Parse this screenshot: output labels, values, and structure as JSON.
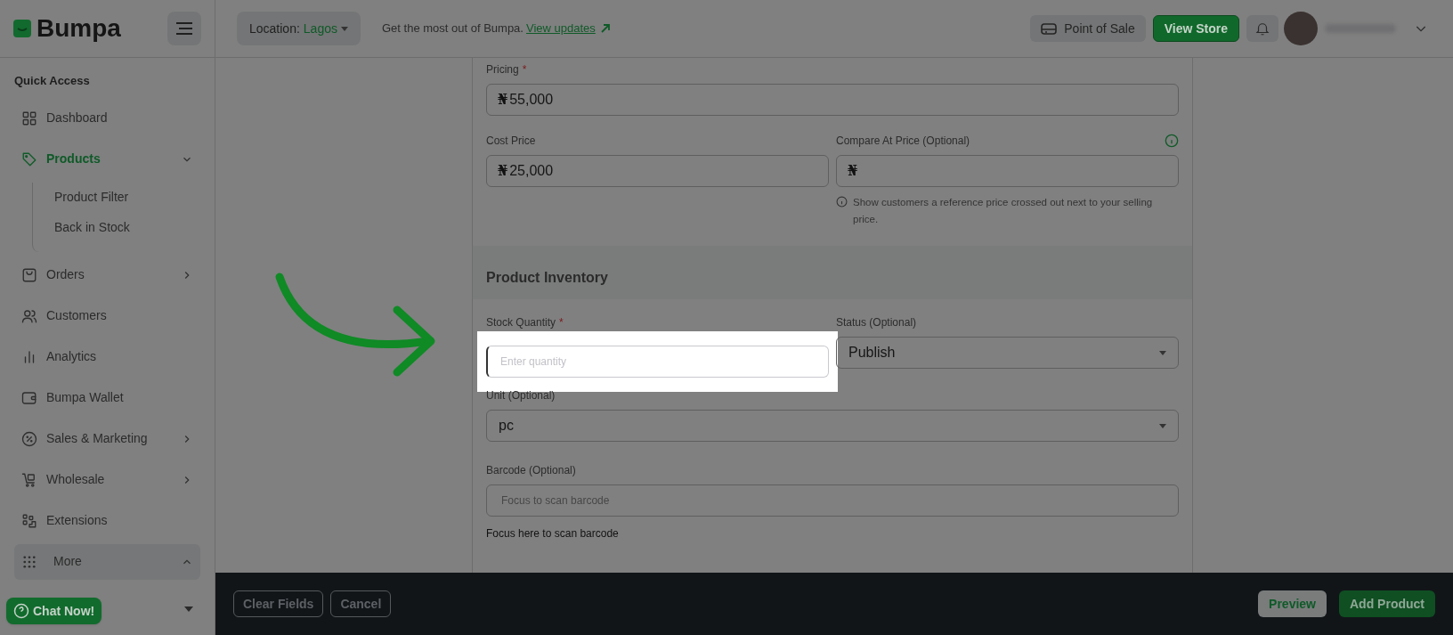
{
  "header": {
    "logo": "Bumpa",
    "location": {
      "label": "Location:",
      "value": "Lagos"
    },
    "promo": "Get the most out of Bumpa.",
    "promo_link": "View updates",
    "pos_button": "Point of Sale",
    "store_button": "View Store"
  },
  "sidebar": {
    "title": "Quick Access",
    "items": [
      {
        "label": "Dashboard",
        "kind": "plain",
        "selected": false
      },
      {
        "label": "Products",
        "kind": "expanded",
        "selected": true,
        "children": [
          {
            "label": "Product Filter"
          },
          {
            "label": "Back in Stock"
          }
        ]
      },
      {
        "label": "Orders",
        "kind": "submenu",
        "selected": false
      },
      {
        "label": "Customers",
        "kind": "plain",
        "selected": false
      },
      {
        "label": "Analytics",
        "kind": "plain",
        "selected": false
      },
      {
        "label": "Bumpa Wallet",
        "kind": "plain",
        "selected": false
      },
      {
        "label": "Sales & Marketing",
        "kind": "submenu",
        "selected": false
      },
      {
        "label": "Wholesale",
        "kind": "submenu",
        "selected": false
      },
      {
        "label": "Extensions",
        "kind": "plain",
        "selected": false
      },
      {
        "label": "More",
        "kind": "toggle",
        "selected": false
      }
    ],
    "chat_button": "Chat Now!"
  },
  "form": {
    "pricing": {
      "label": "Pricing",
      "required_mark": "*",
      "currency": "₦",
      "value": "55,000"
    },
    "cost_price": {
      "label": "Cost Price",
      "currency": "₦",
      "value": "25,000"
    },
    "compare_price": {
      "label": "Compare At Price (Optional)",
      "currency": "₦",
      "help": "Show customers a reference price crossed out next to your selling price."
    },
    "inventory_title": "Product Inventory",
    "stock_quantity": {
      "label": "Stock Quantity",
      "required_mark": "*",
      "placeholder": "Enter quantity",
      "highlighted": true
    },
    "status": {
      "label": "Status (Optional)",
      "value": "Publish"
    },
    "unit": {
      "label": "Unit (Optional)",
      "value": "pc"
    },
    "barcode": {
      "label": "Barcode (Optional)",
      "placeholder": "Focus to scan barcode",
      "hint": "Focus here to scan barcode"
    }
  },
  "footer": {
    "left_buttons": [
      "Clear Fields",
      "Cancel"
    ],
    "preview": "Preview",
    "submit": "Add Product"
  }
}
